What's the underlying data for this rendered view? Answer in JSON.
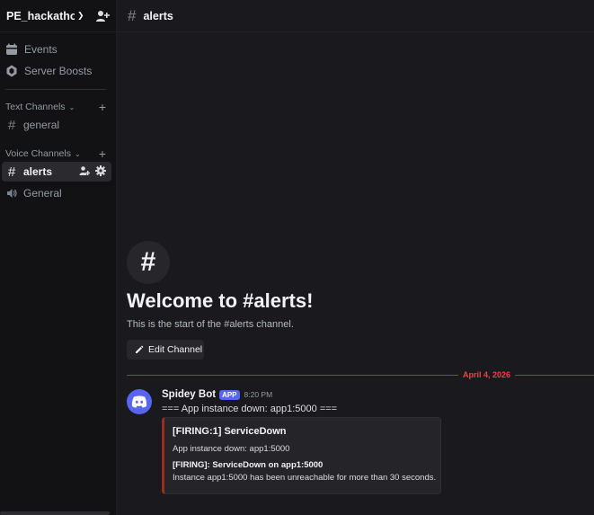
{
  "server": {
    "name": "PE_hackatho..."
  },
  "sidebar": {
    "top_items": [
      {
        "label": "Events",
        "icon": "calendar-icon"
      },
      {
        "label": "Server Boosts",
        "icon": "boost-icon"
      }
    ],
    "categories": [
      {
        "label": "Text Channels",
        "channels": [
          {
            "label": "general",
            "type": "text"
          }
        ]
      },
      {
        "label": "Voice Channels",
        "channels": [
          {
            "label": "alerts",
            "type": "text",
            "active": true
          },
          {
            "label": "General",
            "type": "voice"
          }
        ]
      }
    ]
  },
  "header": {
    "channel": "alerts"
  },
  "welcome": {
    "title": "Welcome to #alerts!",
    "subtitle": "This is the start of the #alerts channel.",
    "edit_button": "Edit Channel"
  },
  "date_divider": "April 4, 2026",
  "message": {
    "author": "Spidey Bot",
    "badge": "APP",
    "time": "8:20 PM",
    "text": "=== App instance down: app1:5000 ===",
    "embed": {
      "title": "[FIRING:1] ServiceDown",
      "line1": "App instance down: app1:5000",
      "line2": "[FIRING]: ServiceDown on app1:5000",
      "line3": "Instance app1:5000 has been unreachable for more than 30 seconds."
    }
  },
  "colors": {
    "accent": "#5865f2",
    "embed_border": "#992d22",
    "date_red": "#f23f43"
  }
}
